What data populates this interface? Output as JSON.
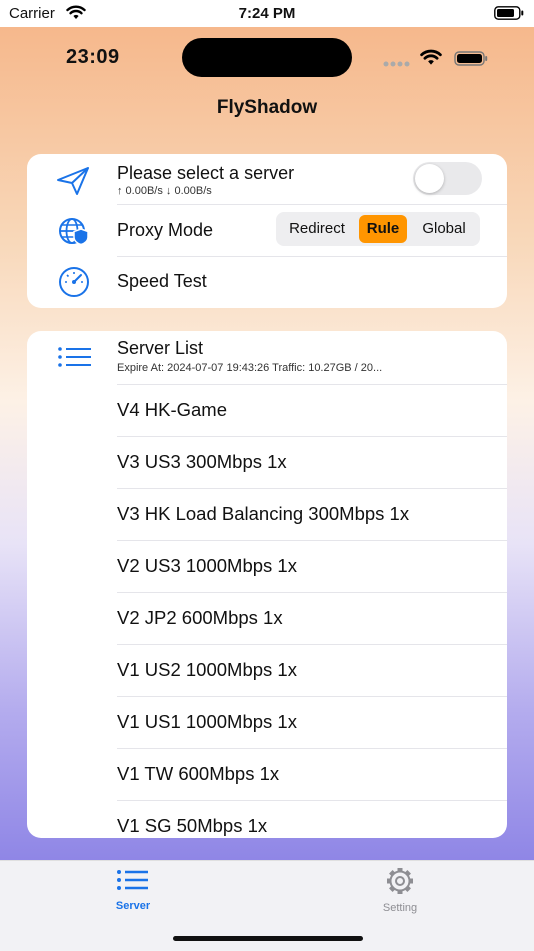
{
  "system_status": {
    "carrier": "Carrier",
    "time": "7:24 PM"
  },
  "phone_status": {
    "time": "23:09"
  },
  "app": {
    "title": "FlyShadow"
  },
  "controls": {
    "server_select_label": "Please select a server",
    "traffic_rate": "↑ 0.00B/s ↓ 0.00B/s",
    "connection_toggle_on": false,
    "proxy_mode_label": "Proxy Mode",
    "proxy_modes": [
      "Redirect",
      "Rule",
      "Global"
    ],
    "proxy_mode_selected": "Rule",
    "speed_test_label": "Speed Test"
  },
  "server_list": {
    "title": "Server List",
    "meta": "Expire At: 2024-07-07 19:43:26 Traffic: 10.27GB / 20...",
    "items": [
      "V4 HK-Game",
      "V3 US3 300Mbps 1x",
      "V3 HK Load Balancing 300Mbps 1x",
      "V2 US3 1000Mbps 1x",
      "V2 JP2 600Mbps 1x",
      "V1 US2 1000Mbps 1x",
      "V1 US1 1000Mbps 1x",
      "V1 TW 600Mbps 1x",
      "V1 SG 50Mbps 1x"
    ]
  },
  "tabs": [
    {
      "label": "Server",
      "icon": "list-icon",
      "active": true
    },
    {
      "label": "Setting",
      "icon": "gear-icon",
      "active": false
    }
  ],
  "colors": {
    "accent": "#1a73e8",
    "segment_active": "#ff9500",
    "tab_inactive": "#8e8e93"
  }
}
